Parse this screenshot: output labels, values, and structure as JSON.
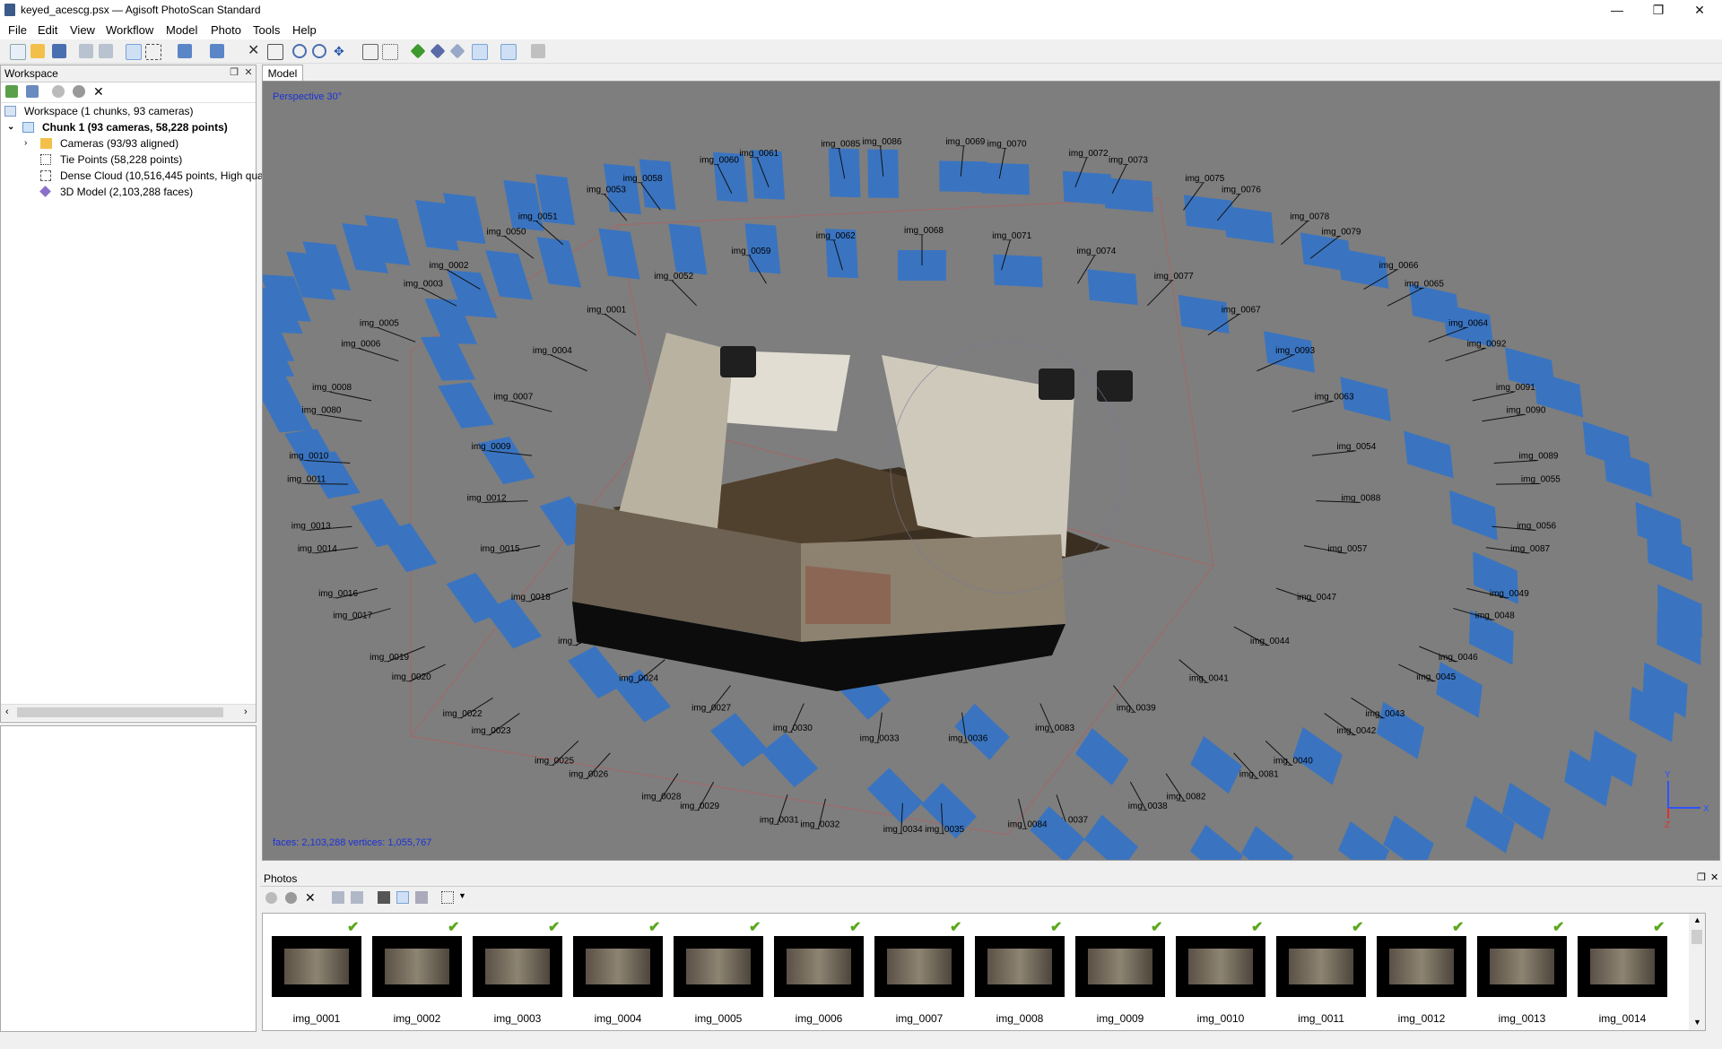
{
  "window": {
    "title": "keyed_acescg.psx — Agisoft PhotoScan Standard",
    "minimize": "—",
    "restore": "❐",
    "close": "✕"
  },
  "menu": [
    "File",
    "Edit",
    "View",
    "Workflow",
    "Model",
    "Photo",
    "Tools",
    "Help"
  ],
  "workspace": {
    "header": "Workspace",
    "root": "Workspace (1 chunks, 93 cameras)",
    "chunk": "Chunk 1 (93 cameras, 58,228 points)",
    "children": [
      {
        "label": "Cameras (93/93 aligned)",
        "icon": "folder-icon"
      },
      {
        "label": "Tie Points (58,228 points)",
        "icon": "tie-points-icon"
      },
      {
        "label": "Dense Cloud (10,516,445 points, High qua",
        "icon": "dense-cloud-icon"
      },
      {
        "label": "3D Model (2,103,288 faces)",
        "icon": "model-icon"
      }
    ]
  },
  "model": {
    "tab": "Model",
    "projection": "Perspective 30°",
    "stats": "faces: 2,103,288 vertices: 1,055,767",
    "axes": {
      "y": "Y",
      "x": "X",
      "z": "Z"
    },
    "camera_labels": [
      "img_0068",
      "img_0069",
      "img_0070",
      "img_0071",
      "img_0072",
      "img_0073",
      "img_0074",
      "img_0075",
      "img_0076",
      "img_0077",
      "img_0078",
      "img_0079",
      "img_0067",
      "img_0066",
      "img_0065",
      "img_0093",
      "img_0064",
      "img_0092",
      "img_0063",
      "img_0091",
      "img_0090",
      "img_0054",
      "img_0089",
      "img_0055",
      "img_0088",
      "img_0056",
      "img_0087",
      "img_0057",
      "img_0049",
      "img_0048",
      "img_0047",
      "img_0046",
      "img_0045",
      "img_0044",
      "img_0043",
      "img_0042",
      "img_0041",
      "img_0040",
      "img_0081",
      "img_0039",
      "img_0082",
      "img_0038",
      "img_0083",
      "img_0037",
      "img_0084",
      "img_0036",
      "img_0035",
      "img_0034",
      "img_0033",
      "img_0032",
      "img_0031",
      "img_0030",
      "img_0029",
      "img_0028",
      "img_0027",
      "img_0026",
      "img_0025",
      "img_0024",
      "img_0023",
      "img_0022",
      "img_0021",
      "img_0020",
      "img_0019",
      "img_0018",
      "img_0017",
      "img_0016",
      "img_0015",
      "img_0014",
      "img_0013",
      "img_0012",
      "img_0011",
      "img_0010",
      "img_0009",
      "img_0080",
      "img_0008",
      "img_0007",
      "img_0006",
      "img_0005",
      "img_0004",
      "img_0003",
      "img_0002",
      "img_0001",
      "img_0050",
      "img_0051",
      "img_0052",
      "img_0053",
      "img_0058",
      "img_0059",
      "img_0060",
      "img_0061",
      "img_0062",
      "img_0085",
      "img_0086"
    ]
  },
  "photos": {
    "header": "Photos",
    "items": [
      "img_0001",
      "img_0002",
      "img_0003",
      "img_0004",
      "img_0005",
      "img_0006",
      "img_0007",
      "img_0008",
      "img_0009",
      "img_0010",
      "img_0011",
      "img_0012",
      "img_0013",
      "img_0014"
    ],
    "check_glyph": "✔"
  },
  "colors": {
    "camera_blue": "#3a74c0",
    "viewport_bg": "#7e7e7e",
    "axis_y": "#2a55ff",
    "axis_x": "#2a55ff",
    "axis_z": "#e03030"
  }
}
